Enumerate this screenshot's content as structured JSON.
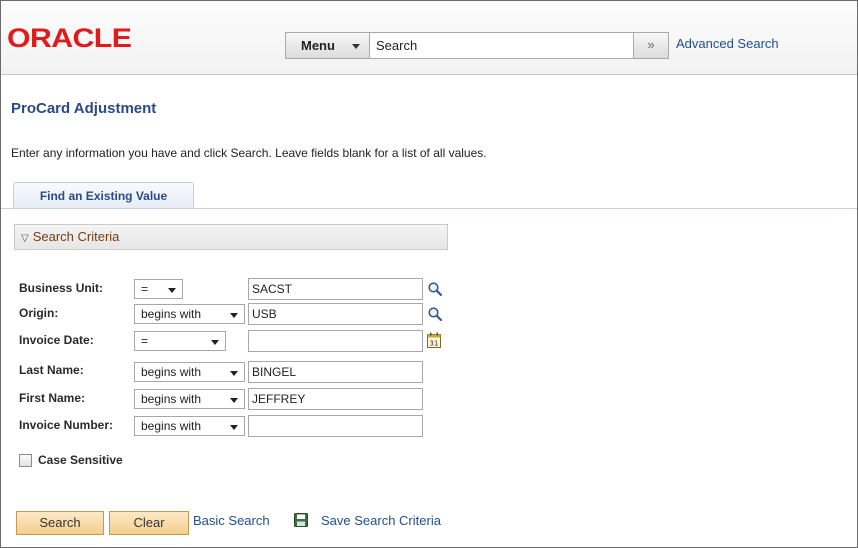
{
  "header": {
    "logo_text": "ORACLE",
    "menu_label": "Menu",
    "search_text": "Search",
    "go_glyph": "»",
    "advanced_search": "Advanced Search"
  },
  "page": {
    "title": "ProCard Adjustment",
    "instructions": "Enter any information you have and click Search. Leave fields blank for a list of all values.",
    "tab_label": "Find an Existing Value",
    "criteria_title": "Search Criteria"
  },
  "fields": {
    "business_unit": {
      "label": "Business Unit:",
      "operator": "=",
      "value": "SACST"
    },
    "origin": {
      "label": "Origin:",
      "operator": "begins with",
      "value": "USB"
    },
    "invoice_date": {
      "label": "Invoice Date:",
      "operator": "=",
      "value": ""
    },
    "last_name": {
      "label": "Last Name:",
      "operator": "begins with",
      "value": "BINGEL"
    },
    "first_name": {
      "label": "First Name:",
      "operator": "begins with",
      "value": "JEFFREY"
    },
    "invoice_number": {
      "label": "Invoice Number:",
      "operator": "begins with",
      "value": ""
    }
  },
  "case_sensitive": {
    "label": "Case Sensitive",
    "checked": false
  },
  "actions": {
    "search": "Search",
    "clear": "Clear",
    "basic_search": "Basic Search",
    "save_criteria": "Save Search Criteria"
  },
  "icons": {
    "lookup": "magnifier-icon",
    "calendar": "calendar-icon",
    "save": "save-disk-icon"
  }
}
